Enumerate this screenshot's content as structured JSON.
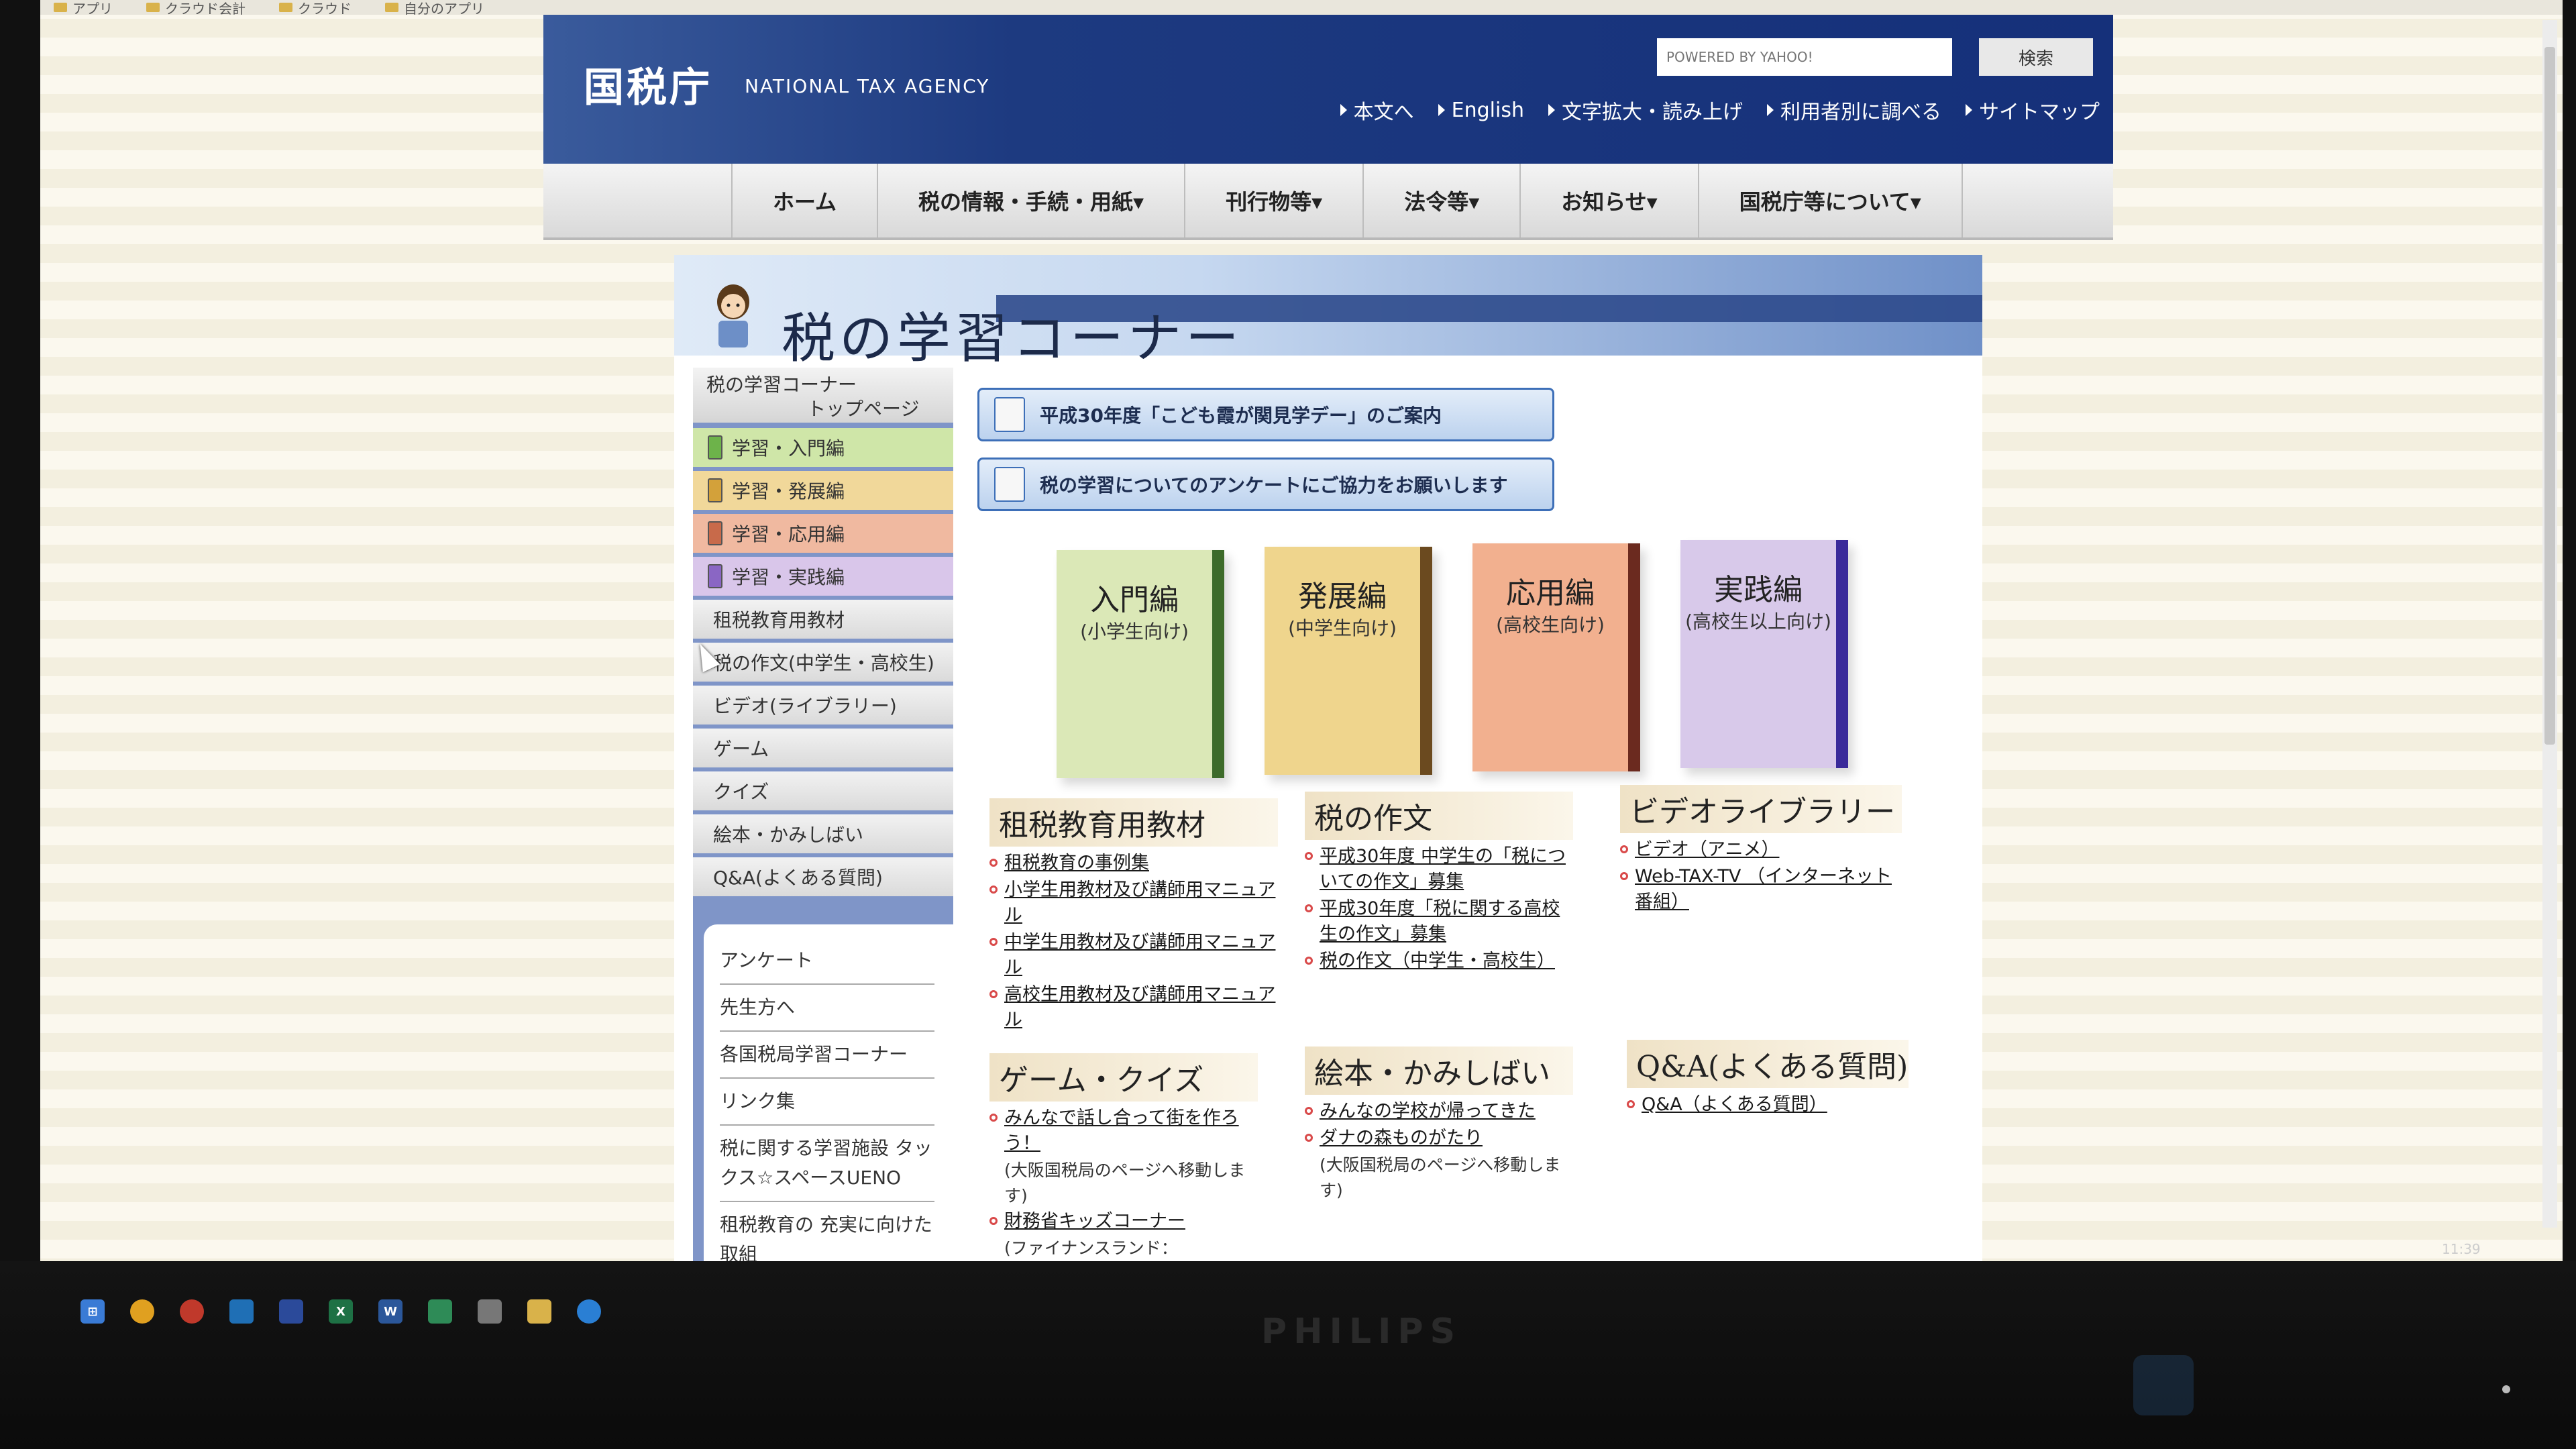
{
  "bookmarks": [
    "アプリ",
    "クラウド会計",
    "クラウド",
    "自分のアプリ"
  ],
  "header": {
    "logo_jp": "国税庁",
    "logo_en": "NATIONAL TAX AGENCY",
    "search_placeholder": "POWERED BY YAHOO!",
    "search_button": "検索",
    "utility": [
      "本文へ",
      "English",
      "文字拡大・読み上げ",
      "利用者別に調べる",
      "サイトマップ"
    ]
  },
  "gnav": [
    "ホーム",
    "税の情報・手続・用紙▾",
    "刊行物等▾",
    "法令等▾",
    "お知らせ▾",
    "国税庁等について▾"
  ],
  "banner": {
    "title": "税の学習コーナー"
  },
  "sidenav": {
    "top_line1": "税の学習コーナー",
    "top_line2": "トップページ",
    "items": [
      {
        "label": "学習・入門編",
        "bg": "#cfe6a8",
        "book": "#6db34a"
      },
      {
        "label": "学習・発展編",
        "bg": "#f1d89a",
        "book": "#d3a13a"
      },
      {
        "label": "学習・応用編",
        "bg": "#f0b9a0",
        "book": "#c86a4a"
      },
      {
        "label": "学習・実践編",
        "bg": "#d9c6ea",
        "book": "#8a66c4"
      },
      {
        "label": "租税教育用教材"
      },
      {
        "label": "税の作文(中学生・高校生)"
      },
      {
        "label": "ビデオ(ライブラリー)"
      },
      {
        "label": "ゲーム"
      },
      {
        "label": "クイズ"
      },
      {
        "label": "絵本・かみしばい"
      },
      {
        "label": "Q&A(よくある質問)"
      }
    ],
    "lower": [
      "アンケート",
      "先生方へ",
      "各国税局学習コーナー",
      "リンク集",
      "税に関する学習施設 タックス☆スペースUENO",
      "租税教育の 充実に向けた取組"
    ]
  },
  "announcements": [
    "平成30年度「こども霞が関見学デー」のご案内",
    "税の学習についてのアンケートにご協力をお願いします"
  ],
  "books": [
    {
      "title": "入門編",
      "sub": "(小学生向け)",
      "color": "#dbe8b7",
      "spine": "#3d6b2a"
    },
    {
      "title": "発展編",
      "sub": "(中学生向け)",
      "color": "#efd58d",
      "spine": "#6b4a1f"
    },
    {
      "title": "応用編",
      "sub": "(高校生向け)",
      "color": "#f2b08f",
      "spine": "#6b2a1f"
    },
    {
      "title": "実践編",
      "sub": "(高校生以上向け)",
      "color": "#d8c9ea",
      "spine": "#3a2a9a"
    }
  ],
  "sections": {
    "sozei": {
      "title": "租税教育用教材",
      "links": [
        "租税教育の事例集",
        "小学生用教材及び講師用マニュアル",
        "中学生用教材及び講師用マニュアル",
        "高校生用教材及び講師用マニュアル"
      ]
    },
    "sakubun": {
      "title": "税の作文",
      "links": [
        "平成30年度 中学生の「税についての作文」募集",
        "平成30年度「税に関する高校生の作文」募集",
        "税の作文（中学生・高校生）"
      ]
    },
    "video": {
      "title": "ビデオライブラリー",
      "links": [
        "ビデオ（アニメ）",
        "Web-TAX-TV （インターネット番組）"
      ]
    },
    "game": {
      "title": "ゲーム・クイズ",
      "link1": "みんなで話し合って街を作ろう！",
      "note1": "(大阪国税局のページへ移動します)",
      "link2": "財務省キッズコーナー",
      "note2": "(ファイナンスランド："
    },
    "ehon": {
      "title": "絵本・かみしばい",
      "link1": "みんなの学校が帰ってきた",
      "link2": "ダナの森ものがたり",
      "note": "(大阪国税局のページへ移動します)"
    },
    "qa": {
      "title": "Q&A(よくある質問)",
      "link1": "Q&A（よくある質問）"
    }
  },
  "brand": "PHILIPS",
  "clock": "11:39",
  "colors": {
    "header": "#15307a",
    "nav_side": "#7f95c8",
    "link_dot": "#d94a4a"
  }
}
